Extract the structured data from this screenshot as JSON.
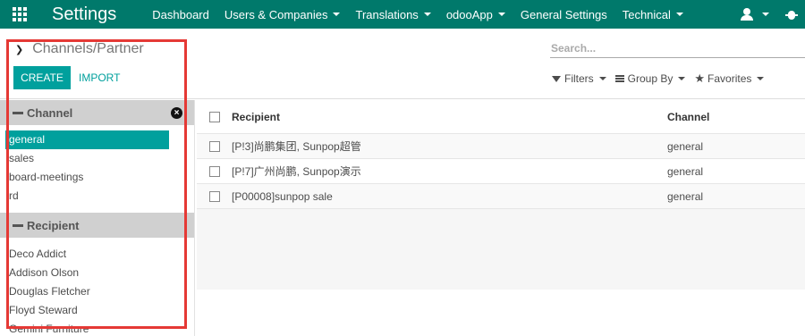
{
  "topbar": {
    "app_title": "Settings",
    "menu": [
      {
        "label": "Dashboard",
        "dropdown": false
      },
      {
        "label": "Users & Companies",
        "dropdown": true
      },
      {
        "label": "Translations",
        "dropdown": true
      },
      {
        "label": "odooApp",
        "dropdown": true
      },
      {
        "label": "General Settings",
        "dropdown": false
      },
      {
        "label": "Technical",
        "dropdown": true
      }
    ],
    "icons": [
      "apps-grid-icon",
      "user-icon",
      "bug-icon"
    ]
  },
  "control_panel": {
    "breadcrumb": "Channels/Partner",
    "create_label": "CREATE",
    "import_label": "IMPORT",
    "search_placeholder": "Search...",
    "filters_label": "Filters",
    "group_by_label": "Group By",
    "favorites_label": "Favorites"
  },
  "sidebar": {
    "channel_header": "Channel",
    "channels": [
      "general",
      "sales",
      "board-meetings",
      "rd"
    ],
    "active_channel": "general",
    "recipient_header": "Recipient",
    "recipients": [
      "Deco Addict",
      "Addison Olson",
      "Douglas Fletcher",
      "Floyd Steward",
      "Gemini Furniture"
    ]
  },
  "list": {
    "columns": [
      "Recipient",
      "Channel"
    ],
    "rows": [
      {
        "recipient": "[P!3]尚鹏集团, Sunpop超管",
        "channel": "general"
      },
      {
        "recipient": "[P!7]广州尚鹏, Sunpop演示",
        "channel": "general"
      },
      {
        "recipient": "[P00008]sunpop sale",
        "channel": "general"
      }
    ]
  },
  "colors": {
    "topbar": "#00796b",
    "primary": "#00a09d",
    "annotation": "#e53935"
  }
}
